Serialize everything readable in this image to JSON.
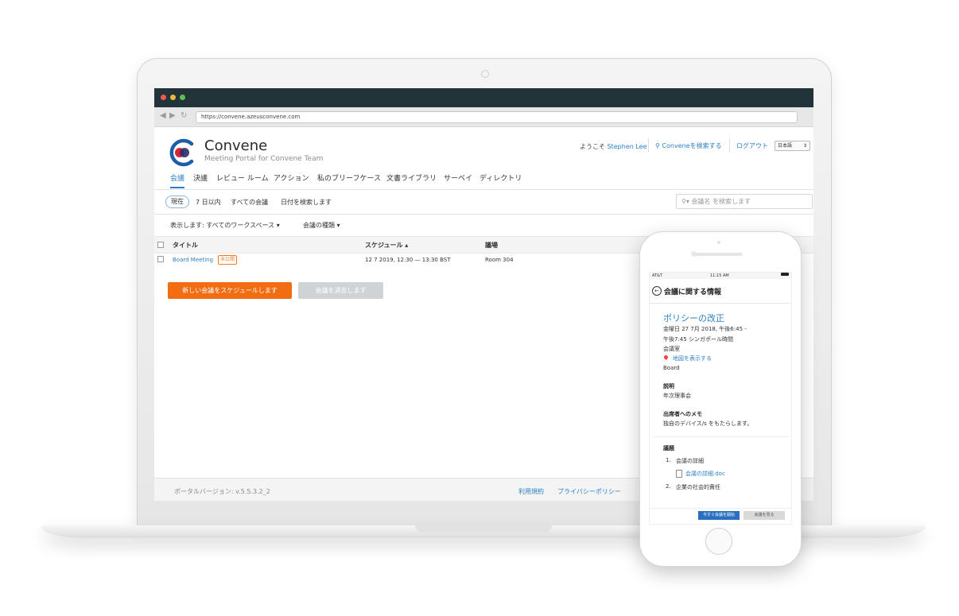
{
  "browser": {
    "url": "https://convene.azeusconvene.com"
  },
  "brand": {
    "name": "Convene",
    "subtitle": "Meeting Portal for Convene Team"
  },
  "header": {
    "welcome_prefix": "ようこそ",
    "user": "Stephen Lee",
    "search_link": "Conveneを検索する",
    "logout": "ログアウト",
    "language": "日本語"
  },
  "tabs": [
    "会議",
    "決議",
    "レビュー ルーム",
    "アクション",
    "私のブリーフケース",
    "文書ライブラリ",
    "サーベイ",
    "ディレクトリ"
  ],
  "subtabs": {
    "current": "現在",
    "week": "7 日以内",
    "all": "すべての会議",
    "date": "日付を検索します"
  },
  "search": {
    "placeholder": "会議名 を検索します"
  },
  "filters": {
    "show": "表示します: すべてのワークスペース",
    "type": "会議の種類"
  },
  "table": {
    "headers": {
      "title": "タイトル",
      "schedule": "スケジュール",
      "venue": "議場"
    },
    "rows": [
      {
        "title": "Board Meeting",
        "badge": "未公開",
        "schedule": "12 7 2019, 12:30 — 13:30 BST",
        "venue": "Room 304"
      }
    ]
  },
  "buttons": {
    "new_meeting": "新しい会議をスケジュールします",
    "delete_meeting": "会議を消去します"
  },
  "footer": {
    "version": "ポータルバージョン: v.5.5.3.2_2",
    "terms": "利用規約",
    "privacy": "プライバシーポリシー"
  },
  "phone": {
    "status": {
      "carrier": "AT&T",
      "time": "11:15 AM"
    },
    "header_title": "会議に関する情報",
    "event_title": "ポリシーの改正",
    "datetime_line1": "金曜日 27 7月 2018, 午後6:45 -",
    "datetime_line2": "午後7:45 シンガポール時間",
    "room_label": "会議室",
    "map_link": "地図を表示する",
    "board": "Board",
    "desc_label": "説明",
    "desc_value": "年次理事会",
    "memo_label": "出席者へのメモ",
    "memo_value": "独自のデバイス/s をもたらします。",
    "agenda_label": "議題",
    "agenda": [
      {
        "num": "1.",
        "title": "会議の詳細",
        "file": "会議の詳細.doc"
      },
      {
        "num": "2.",
        "title": "企業の社会的責任"
      }
    ],
    "btn_join": "今すぐ会議を開始",
    "btn_view": "会議を見る"
  },
  "colors": {
    "accent": "#2a7fc8",
    "primary_button": "#f26c12",
    "titlebar": "#22343a"
  }
}
